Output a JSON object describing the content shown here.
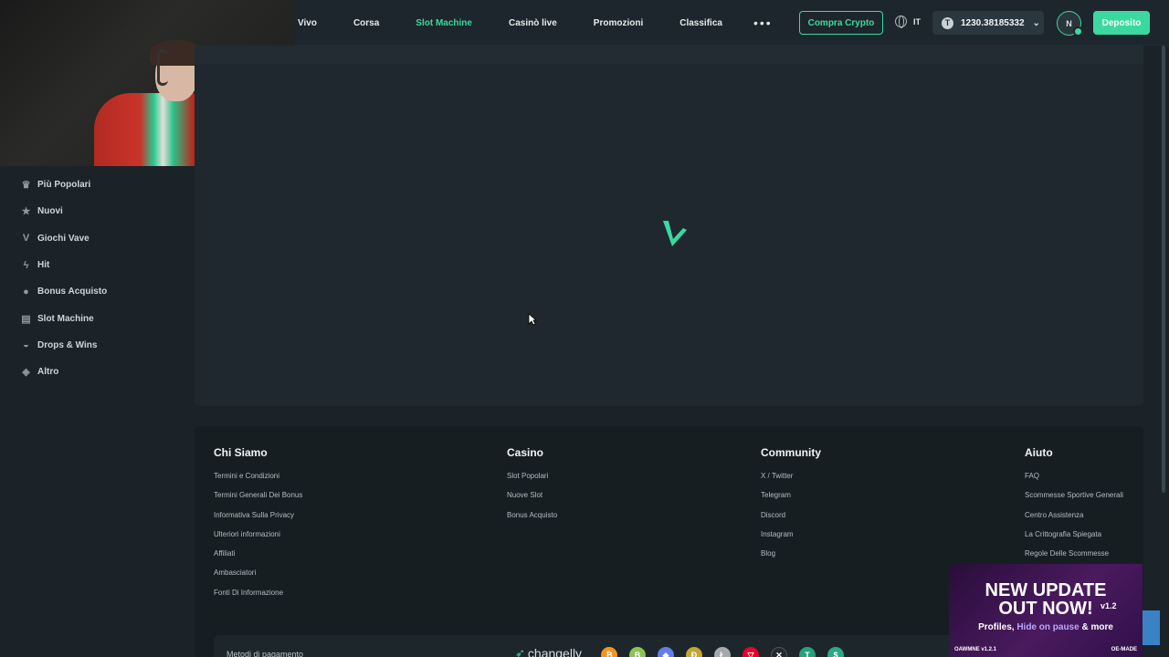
{
  "nav": {
    "items": [
      {
        "label": "Vivo",
        "active": false
      },
      {
        "label": "Corsa",
        "active": false
      },
      {
        "label": "Slot Machine",
        "active": true
      },
      {
        "label": "Casinò live",
        "active": false
      },
      {
        "label": "Promozioni",
        "active": false
      },
      {
        "label": "Classifica",
        "active": false
      }
    ],
    "more_label": "•••"
  },
  "header": {
    "buy_crypto": "Compra Crypto",
    "language": "IT",
    "balance": "1230.38185332",
    "currency_symbol": "T",
    "avatar_initial": "N",
    "deposit": "Deposito"
  },
  "sidebar": {
    "items": [
      {
        "label": "Più Popolari",
        "icon": "crown-icon",
        "glyph": "♛"
      },
      {
        "label": "Nuovi",
        "icon": "star-icon",
        "glyph": "★"
      },
      {
        "label": "Giochi Vave",
        "icon": "vave-icon",
        "glyph": "V"
      },
      {
        "label": "Hit",
        "icon": "lightning-icon",
        "glyph": "ϟ"
      },
      {
        "label": "Bonus Acquisto",
        "icon": "money-bag-icon",
        "glyph": "●"
      },
      {
        "label": "Slot Machine",
        "icon": "slot-machine-icon",
        "glyph": "▤"
      },
      {
        "label": "Drops & Wins",
        "icon": "drops-icon",
        "glyph": "◒"
      },
      {
        "label": "Altro",
        "icon": "cube-icon",
        "glyph": "◈"
      }
    ]
  },
  "footer": {
    "columns": [
      {
        "title": "Chi Siamo",
        "links": [
          "Termini e Condizioni",
          "Termini Generali Dei Bonus",
          "Informativa Sulla Privacy",
          "Ulteriori informazioni",
          "Affiliati",
          "Ambasciatori",
          "Fonti Di Informazione"
        ]
      },
      {
        "title": "Casino",
        "links": [
          "Slot Popolari",
          "Nuove Slot",
          "Bonus Acquisto"
        ]
      },
      {
        "title": "Community",
        "links": [
          "X / Twitter",
          "Telegram",
          "Discord",
          "Instagram",
          "Blog"
        ]
      },
      {
        "title": "Aiuto",
        "links": [
          "FAQ",
          "Scommesse Sportive Generali",
          "Centro Assistenza",
          "La Crittografia Spiegata",
          "Regole Delle Scommesse"
        ]
      }
    ],
    "payments_label": "Metodi di pagamento",
    "changelly": "changelly",
    "coins": [
      {
        "icon": "bitcoin-icon",
        "glyph": "₿",
        "color": "#f7931a"
      },
      {
        "icon": "bitcoin-cash-icon",
        "glyph": "B",
        "color": "#8dc351"
      },
      {
        "icon": "ethereum-icon",
        "glyph": "◆",
        "color": "#627eea"
      },
      {
        "icon": "dogecoin-icon",
        "glyph": "Ð",
        "color": "#c2a633"
      },
      {
        "icon": "litecoin-icon",
        "glyph": "Ł",
        "color": "#a6a9aa"
      },
      {
        "icon": "tron-icon",
        "glyph": "▽",
        "color": "#eb0029"
      },
      {
        "icon": "xrp-icon",
        "glyph": "✕",
        "color": "#23292f"
      },
      {
        "icon": "tether-icon",
        "glyph": "T",
        "color": "#26a17b"
      },
      {
        "icon": "usdc-icon",
        "glyph": "$",
        "color": "#2aa88a"
      }
    ]
  },
  "promo": {
    "line1": "NEW UPDATE",
    "line2": "OUT NOW!",
    "version": "v1.2",
    "line3_a": "Profiles,",
    "line3_b": "Hide on pause",
    "line3_c": "& more",
    "brand_left": "OAWMNE v1.2.1",
    "brand_right": "OE-MADE"
  },
  "colors": {
    "accent": "#3bd9a0",
    "background": "#1b2329",
    "footer": "#171e22"
  }
}
